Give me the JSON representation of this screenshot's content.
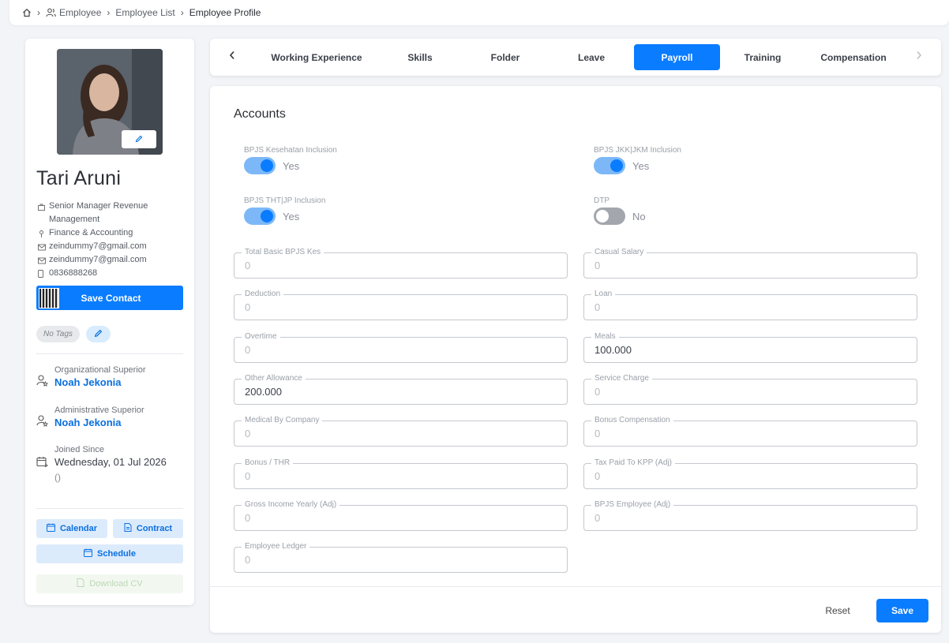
{
  "breadcrumb": {
    "items": [
      "Employee",
      "Employee List",
      "Employee Profile"
    ],
    "icons": [
      "home-icon",
      "users-icon"
    ]
  },
  "profile": {
    "name": "Tari Aruni",
    "position": "Senior Manager Revenue Management",
    "department": "Finance & Accounting",
    "email_1": "zeindummy7@gmail.com",
    "email_2": "zeindummy7@gmail.com",
    "phone": "0836888268",
    "save_contact_label": "Save Contact",
    "tag": "No Tags",
    "org_superior_label": "Organizational Superior",
    "org_superior": "Noah Jekonia",
    "admin_superior_label": "Administrative Superior",
    "admin_superior": "Noah Jekonia",
    "joined_label": "Joined Since",
    "joined_date": "Wednesday, 01 Jul 2026",
    "joined_extra": "()",
    "buttons": {
      "calendar": "Calendar",
      "contract": "Contract",
      "schedule": "Schedule",
      "download_cv": "Download CV"
    }
  },
  "tabs": [
    {
      "label": "Working Experience",
      "active": false
    },
    {
      "label": "Skills",
      "active": false
    },
    {
      "label": "Folder",
      "active": false
    },
    {
      "label": "Leave",
      "active": false
    },
    {
      "label": "Payroll",
      "active": true
    },
    {
      "label": "Training",
      "active": false
    },
    {
      "label": "Compensation",
      "active": false
    }
  ],
  "accounts": {
    "title": "Accounts",
    "toggles": {
      "bpjs_kesehatan": {
        "label": "BPJS Kesehatan Inclusion",
        "state": "Yes",
        "on": true
      },
      "bpjs_jkk": {
        "label": "BPJS JKK|JKM Inclusion",
        "state": "Yes",
        "on": true
      },
      "bpjs_tht": {
        "label": "BPJS THT|JP Inclusion",
        "state": "Yes",
        "on": true
      },
      "dtp": {
        "label": "DTP",
        "state": "No",
        "on": false
      }
    },
    "fields": {
      "total_basic": {
        "label": "Total Basic BPJS Kes",
        "value": "0"
      },
      "casual_salary": {
        "label": "Casual Salary",
        "value": "0"
      },
      "deduction": {
        "label": "Deduction",
        "value": "0"
      },
      "loan": {
        "label": "Loan",
        "value": "0"
      },
      "overtime": {
        "label": "Overtime",
        "value": "0"
      },
      "meals": {
        "label": "Meals",
        "value": "100.000"
      },
      "other_allowance": {
        "label": "Other Allowance",
        "value": "200.000"
      },
      "service_charge": {
        "label": "Service Charge",
        "value": "0"
      },
      "medical": {
        "label": "Medical By Company",
        "value": "0"
      },
      "bonus_comp": {
        "label": "Bonus Compensation",
        "value": "0"
      },
      "bonus_thr": {
        "label": "Bonus / THR",
        "value": "0"
      },
      "tax_paid": {
        "label": "Tax Paid To KPP (Adj)",
        "value": "0"
      },
      "gross_income": {
        "label": "Gross Income Yearly (Adj)",
        "value": "0"
      },
      "bpjs_employee": {
        "label": "BPJS Employee (Adj)",
        "value": "0"
      },
      "employee_ledger": {
        "label": "Employee Ledger",
        "value": "0"
      }
    },
    "reset_label": "Reset",
    "save_label": "Save"
  },
  "colors": {
    "primary": "#0a7cff",
    "link": "#0a6fe0",
    "toggle_track_on": "#7cb8f7",
    "toggle_track_off": "#a3a7ad"
  }
}
